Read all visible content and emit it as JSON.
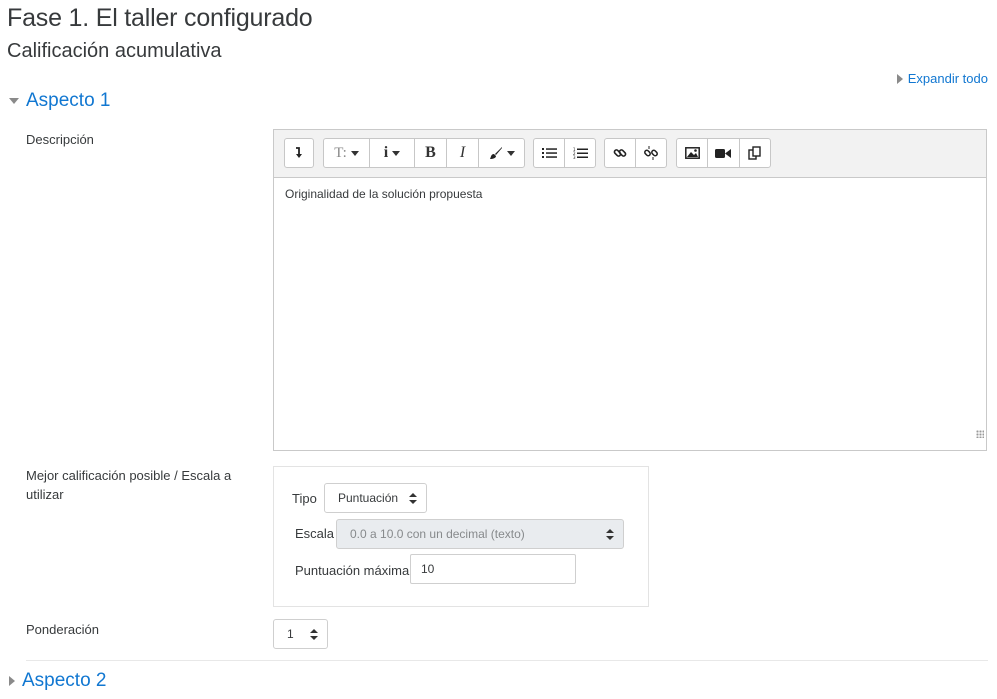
{
  "page": {
    "title": "Fase 1. El taller configurado",
    "subtitle": "Calificación acumulativa",
    "expand_all": "Expandir todo"
  },
  "aspect1": {
    "header": "Aspecto 1",
    "description_label": "Descripción",
    "editor": {
      "toolbar": {
        "groups": [
          [
            "collapse-icon"
          ],
          [
            "text-style-icon",
            "info-icon",
            "bold-icon",
            "italic-icon",
            "brush-icon"
          ],
          [
            "bullet-list-icon",
            "numbered-list-icon"
          ],
          [
            "link-icon",
            "unlink-icon"
          ],
          [
            "image-icon",
            "video-icon",
            "file-manager-icon"
          ]
        ],
        "labels": {
          "text_style": "T:",
          "info": "i",
          "bold": "B",
          "italic": "I"
        }
      },
      "content": "Originalidad de la solución propuesta"
    },
    "grade_label": "Mejor calificación posible / Escala a utilizar",
    "grade": {
      "type_label": "Tipo",
      "type_value": "Puntuación",
      "scale_label": "Escala",
      "scale_value": "0.0 a 10.0 con un decimal (texto)",
      "max_label": "Puntuación máxima",
      "max_value": "10"
    },
    "weight_label": "Ponderación",
    "weight_value": "1"
  },
  "aspect2": {
    "header": "Aspecto 2"
  },
  "colors": {
    "link": "#1177d1",
    "text": "#373a3c",
    "toolbar_bg": "#f2f2f2",
    "border": "#c9c9c9"
  }
}
